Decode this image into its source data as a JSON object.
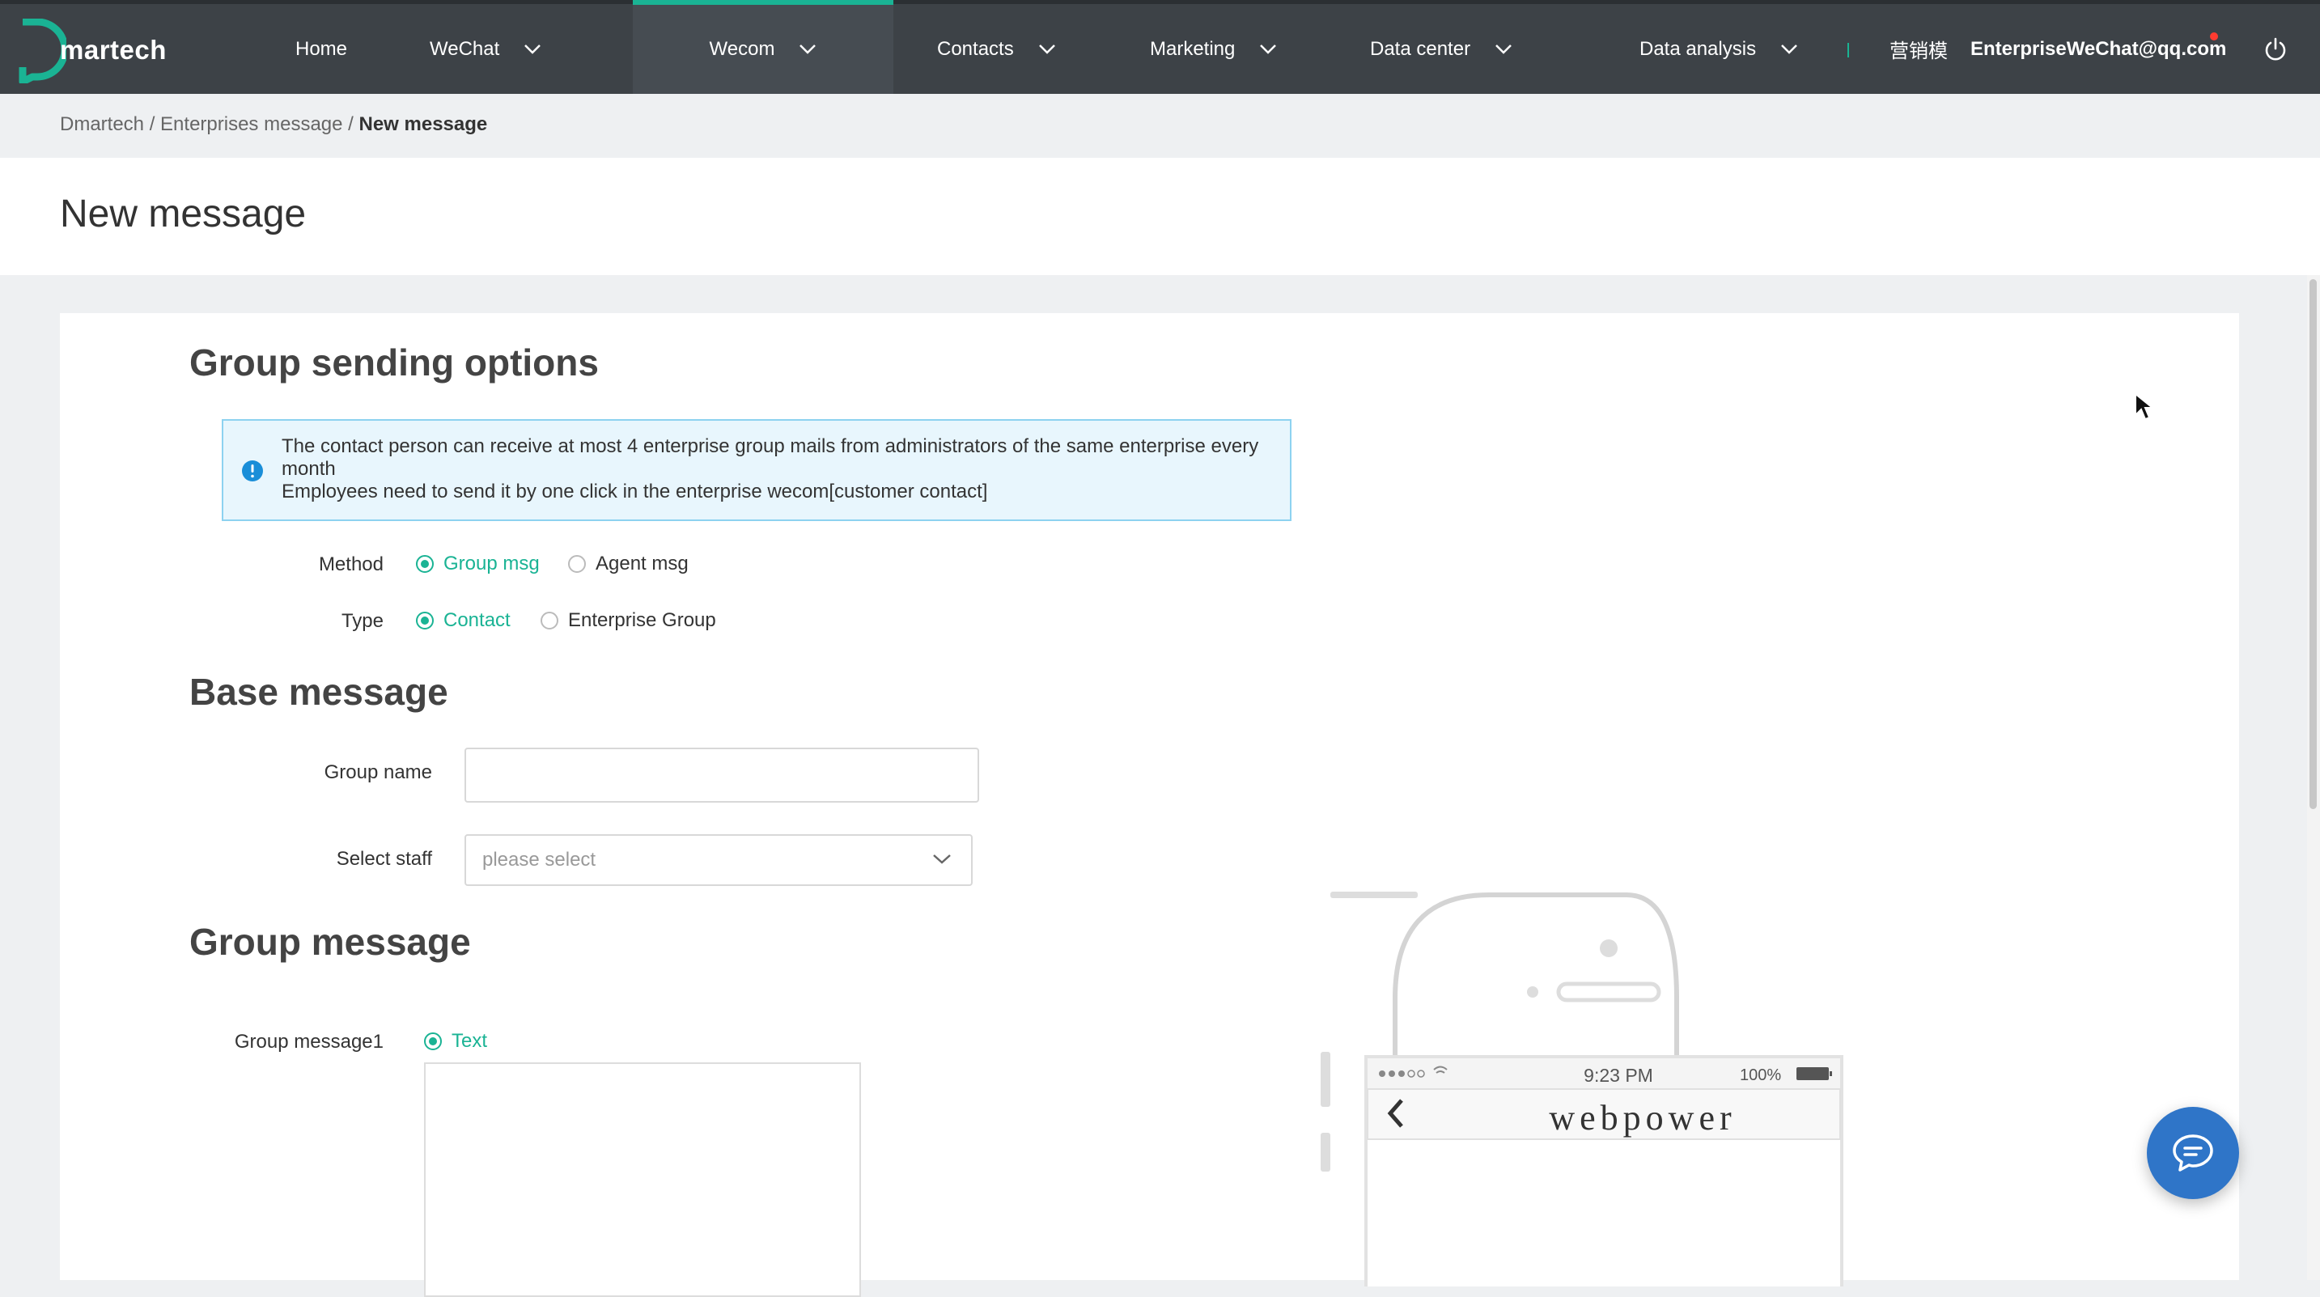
{
  "nav": {
    "logo_text": "martech",
    "items": [
      {
        "label": "Home",
        "has_dropdown": false
      },
      {
        "label": "WeChat",
        "has_dropdown": true
      },
      {
        "label": "Wecom",
        "has_dropdown": true,
        "active": true
      },
      {
        "label": "Contacts",
        "has_dropdown": true
      },
      {
        "label": "Marketing",
        "has_dropdown": true
      },
      {
        "label": "Data center",
        "has_dropdown": true
      },
      {
        "label": "Data analysis",
        "has_dropdown": true
      }
    ],
    "user_cn": "营销模",
    "user_email": "EnterpriseWeChat@qq.com",
    "accent_color": "#1ab394",
    "bar_color": "#3d4247"
  },
  "breadcrumb": {
    "items": [
      "Dmartech",
      "Enterprises message"
    ],
    "separator": "/",
    "current": "New message"
  },
  "page": {
    "title": "New message"
  },
  "group_sending": {
    "title": "Group sending options",
    "alert_line1": "The contact person can receive at most 4 enterprise group mails from administrators of the same enterprise  every month",
    "alert_line2": "Employees need to send it by one click in the enterprise wecom[customer contact]",
    "method_label": "Method",
    "method_options": [
      "Group msg",
      "Agent msg"
    ],
    "method_selected": "Group msg",
    "type_label": "Type",
    "type_options": [
      "Contact",
      "Enterprise Group"
    ],
    "type_selected": "Contact"
  },
  "base_message": {
    "title": "Base message",
    "group_name_label": "Group name",
    "group_name_value": "",
    "select_staff_label": "Select staff",
    "select_staff_placeholder": "please select"
  },
  "group_message": {
    "title": "Group message",
    "msg1_label": "Group message1",
    "msg1_option": "Text",
    "msg1_value": ""
  },
  "phone_preview": {
    "time": "9:23 PM",
    "battery": "100%",
    "brand": "webpower"
  },
  "icons": {
    "power": "power-icon",
    "chat": "chat-bubble-icon",
    "info": "info-icon"
  }
}
